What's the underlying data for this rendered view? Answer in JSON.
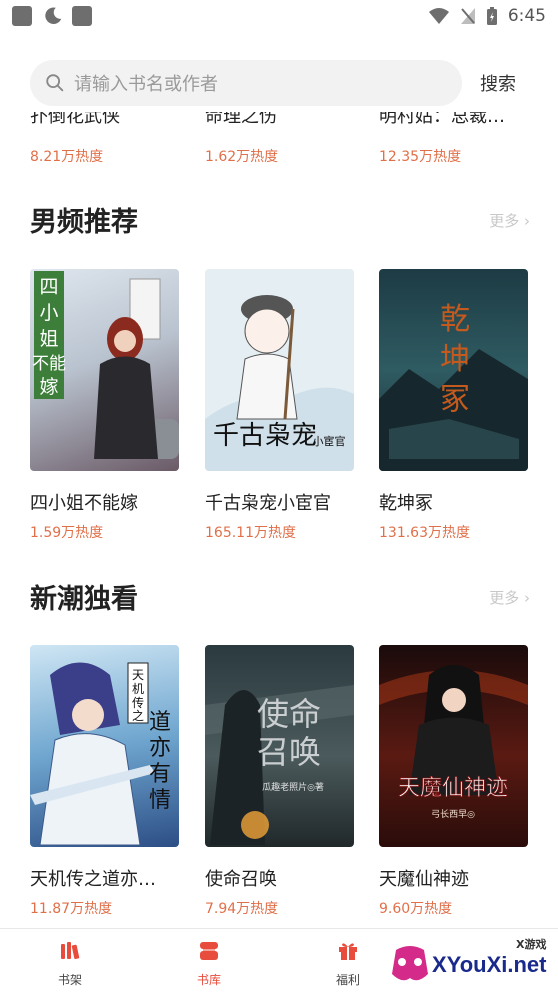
{
  "status_bar": {
    "time": "6:45"
  },
  "search": {
    "placeholder": "请输入书名或作者",
    "button": "搜索"
  },
  "previous_row": [
    {
      "title": "扑倒花武侠",
      "heat": "8.21万热度"
    },
    {
      "title": "命理之伤",
      "heat": "1.62万热度"
    },
    {
      "title": "明村姑：总裁…",
      "heat": "12.35万热度"
    }
  ],
  "sections": [
    {
      "title": "男频推荐",
      "more": "更多 ›",
      "books": [
        {
          "title": "四小姐不能嫁",
          "heat": "1.59万热度",
          "cover_text": "四小姐不能嫁"
        },
        {
          "title": "千古枭宠小宦官",
          "heat": "165.11万热度",
          "cover_text": "千古枭宠",
          "cover_small": "小宦官"
        },
        {
          "title": "乾坤冢",
          "heat": "131.63万热度",
          "cover_text": "乾坤冢"
        }
      ]
    },
    {
      "title": "新潮独看",
      "more": "更多 ›",
      "books": [
        {
          "title": "天机传之道亦…",
          "heat": "11.87万热度",
          "cover_text": "天机传之",
          "cover_text2": "道亦有情"
        },
        {
          "title": "使命召唤",
          "heat": "7.94万热度",
          "cover_text": "使命召唤",
          "cover_small": "瓜趣老照片◎著"
        },
        {
          "title": "天魔仙神迹",
          "heat": "9.60万热度",
          "cover_text": "天魔仙神迹",
          "cover_small": "弓长西早◎"
        }
      ]
    }
  ],
  "bottom_nav": [
    {
      "label": "书架",
      "icon": "bookshelf-icon"
    },
    {
      "label": "书库",
      "icon": "library-icon",
      "active": true
    },
    {
      "label": "福利",
      "icon": "gift-icon"
    }
  ],
  "watermark": {
    "text": "XYouXi.net",
    "small": "X游戏"
  },
  "colors": {
    "accent": "#e74c3c",
    "heat": "#e0704a",
    "muted": "#c8c8c8"
  }
}
